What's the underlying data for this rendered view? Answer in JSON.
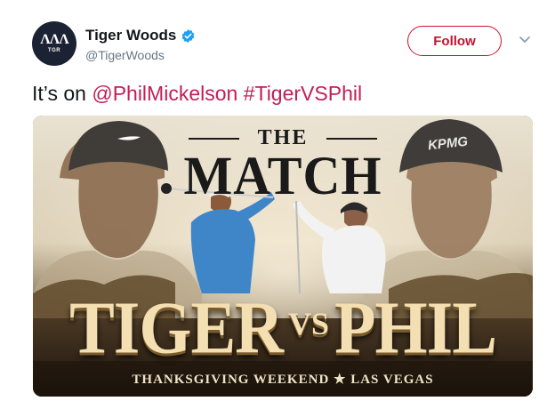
{
  "author": {
    "display_name": "Tiger Woods",
    "handle": "@TigerWoods",
    "avatar_text": "TGR",
    "verified": true
  },
  "actions": {
    "follow_label": "Follow"
  },
  "tweet": {
    "text_prefix": "It’s on ",
    "mention": "@PhilMickelson",
    "space": " ",
    "hashtag": "#TigerVSPhil"
  },
  "media": {
    "title_small": "THE",
    "title_big": "MATCH",
    "name_left": "TIGER",
    "vs": "VS",
    "name_right": "PHIL",
    "subtitle": "THANKSGIVING WEEKEND ★ LAS VEGAS",
    "cap_brand_right": "KPMG"
  },
  "colors": {
    "accent": "#c4122f",
    "link": "#c21e56",
    "verified_blue": "#1da1f2"
  },
  "icons": [
    "verified-badge-icon",
    "chevron-down-icon",
    "nike-swoosh-icon"
  ]
}
